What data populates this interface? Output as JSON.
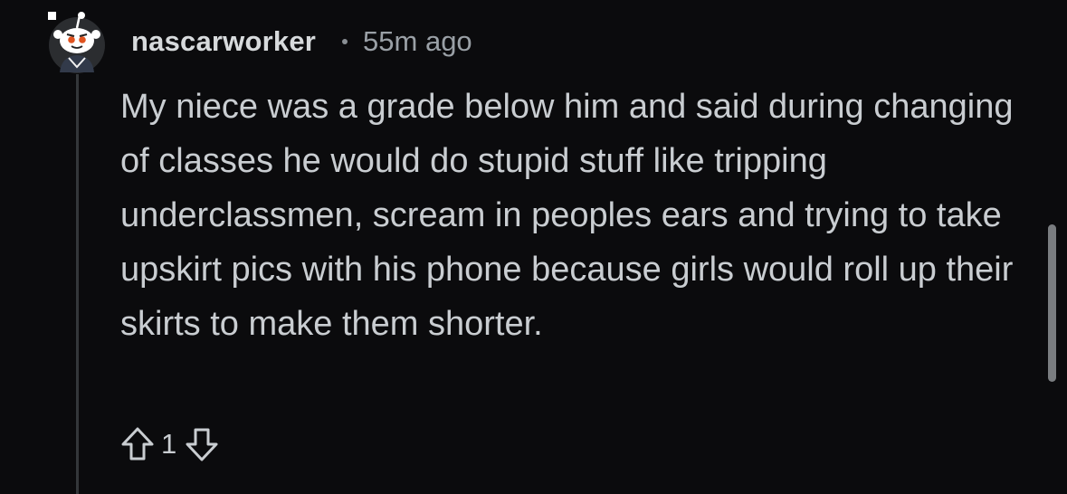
{
  "comment": {
    "author": "nascarworker",
    "separator": "•",
    "timestamp": "55m ago",
    "body": "My niece was a grade below him and said during changing of classes he would do stupid stuff like tripping underclassmen, scream in peoples ears and trying to take upskirt pics with his phone because girls would roll up their skirts to make them shorter.",
    "score": "1"
  },
  "icons": {
    "avatar": "snoo-avatar",
    "upvote": "upvote-arrow-icon",
    "downvote": "downvote-arrow-icon"
  },
  "colors": {
    "background": "#0b0b0d",
    "text": "#c9cdd1",
    "username": "#d7dadc",
    "muted": "#9aa0a6",
    "thread_line": "#34373a"
  }
}
